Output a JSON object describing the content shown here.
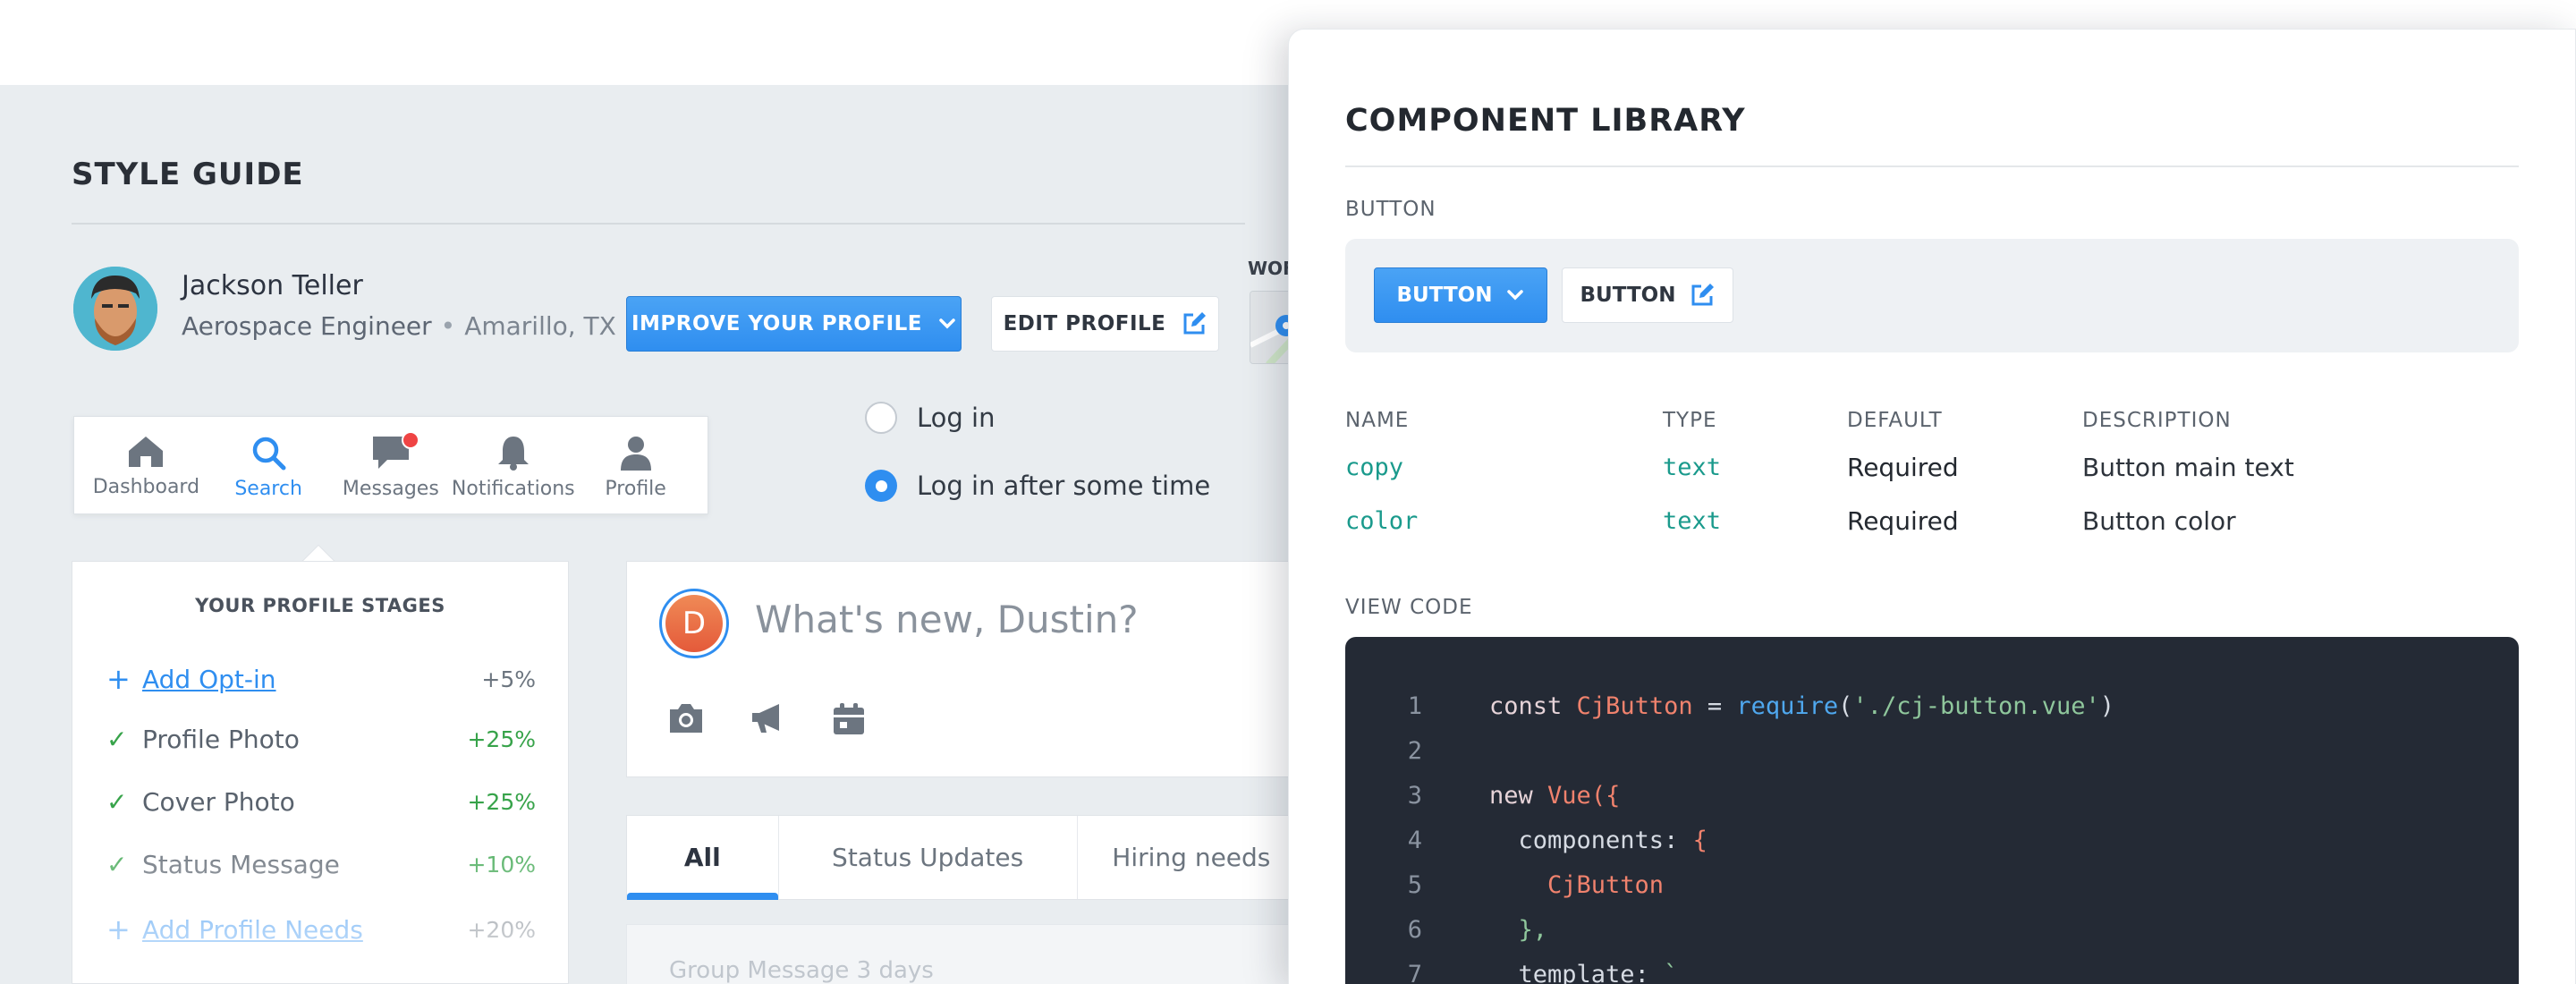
{
  "style_guide": {
    "title": "STYLE GUIDE",
    "user": {
      "name": "Jackson Teller",
      "role": "Aerospace Engineer",
      "separator": "•",
      "location": "Amarillo, TX"
    },
    "primary_button": "IMPROVE YOUR PROFILE",
    "secondary_button": "EDIT PROFILE",
    "truncated_label": "WOF",
    "nav": [
      {
        "label": "Dashboard",
        "icon": "home-icon",
        "active": false
      },
      {
        "label": "Search",
        "icon": "search-icon",
        "active": true
      },
      {
        "label": "Messages",
        "icon": "chat-icon",
        "active": false,
        "badge": true
      },
      {
        "label": "Notifications",
        "icon": "bell-icon",
        "active": false
      },
      {
        "label": "Profile",
        "icon": "user-icon",
        "active": false
      }
    ],
    "radios": [
      {
        "label": "Log in",
        "checked": false
      },
      {
        "label": "Log in after some time",
        "checked": true
      }
    ],
    "stages": {
      "title": "YOUR PROFILE STAGES",
      "items": [
        {
          "label": "Add Opt-in",
          "value": "+5%",
          "status": "add"
        },
        {
          "label": "Profile Photo",
          "value": "+25%",
          "status": "done"
        },
        {
          "label": "Cover Photo",
          "value": "+25%",
          "status": "done"
        },
        {
          "label": "Status Message",
          "value": "+10%",
          "status": "done"
        },
        {
          "label": "Add Profile Needs",
          "value": "+20%",
          "status": "add"
        }
      ]
    },
    "composer": {
      "avatar_initial": "D",
      "prompt": "What's new, Dustin?"
    },
    "tabs": [
      {
        "label": "All",
        "active": true
      },
      {
        "label": "Status Updates",
        "active": false
      },
      {
        "label": "Hiring needs",
        "active": false
      }
    ],
    "feed_preview": "Group Message  3 days"
  },
  "component_library": {
    "title": "COMPONENT LIBRARY",
    "button_section": "BUTTON",
    "preview_primary": "BUTTON",
    "preview_secondary": "BUTTON",
    "props_headers": [
      "NAME",
      "TYPE",
      "DEFAULT",
      "DESCRIPTION"
    ],
    "props": [
      {
        "name": "copy",
        "type": "text",
        "default": "Required",
        "description": "Button main text"
      },
      {
        "name": "color",
        "type": "text",
        "default": "Required",
        "description": "Button color"
      }
    ],
    "code_section": "VIEW CODE",
    "code_lines": [
      {
        "n": "1",
        "text": "const CjButton = require('./cj-button.vue')"
      },
      {
        "n": "2",
        "text": ""
      },
      {
        "n": "3",
        "text": "new Vue({"
      },
      {
        "n": "4",
        "text": "  components: {"
      },
      {
        "n": "5",
        "text": "    CjButton"
      },
      {
        "n": "6",
        "text": "  },"
      },
      {
        "n": "7",
        "text": "  template: `"
      }
    ]
  },
  "colors": {
    "accent": "#2f8ef0",
    "success": "#37a34a",
    "code_bg": "#242a35"
  }
}
